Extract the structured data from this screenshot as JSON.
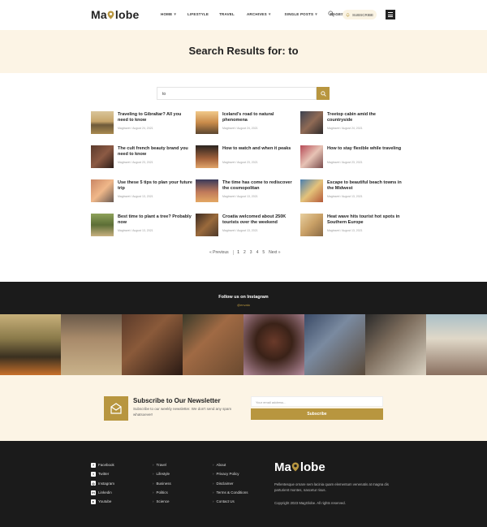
{
  "brand": {
    "logo_pre": "Ma",
    "logo_post": "lobe",
    "accent": "#b8963f",
    "cream": "#fcf4e5",
    "dark": "#1b1b1b"
  },
  "header": {
    "nav": [
      {
        "label": "Home",
        "has_dropdown": true
      },
      {
        "label": "Lifestyle",
        "has_dropdown": false
      },
      {
        "label": "Travel",
        "has_dropdown": false
      },
      {
        "label": "Archives",
        "has_dropdown": true
      },
      {
        "label": "Single Posts",
        "has_dropdown": true
      },
      {
        "label": "Pages",
        "has_dropdown": true
      }
    ],
    "search_icon": "search-icon",
    "subscribe_label": "Subscribe",
    "menu_icon": "hamburger-icon"
  },
  "page": {
    "title": "Search Results for: to"
  },
  "search": {
    "value": "to",
    "button_icon": "search-icon"
  },
  "results": [
    {
      "title": "Traveling to Gibraltar? All you need to know",
      "meta": "Magtravel / August 24, 2021"
    },
    {
      "title": "Iceland’s road to natural phenomena",
      "meta": "Magtravel / August 24, 2021"
    },
    {
      "title": "Treetop cabin amid the countryside",
      "meta": "Magtravel / August 24, 2021"
    },
    {
      "title": "The cult french beauty brand you need to know",
      "meta": "Magtravel / August 23, 2021"
    },
    {
      "title": "How to watch and when it peaks",
      "meta": "Magtravel / August 23, 2021"
    },
    {
      "title": "How to stay flexible while traveling",
      "meta": "Magtravel / August 23, 2021"
    },
    {
      "title": "Use these 5 tips to plan your future trip",
      "meta": "Magtravel / August 13, 2021"
    },
    {
      "title": "The time has come to rediscover the cosmopolitan",
      "meta": "Magtravel / August 13, 2021"
    },
    {
      "title": "Escape to beautiful beach towns in the Midwest",
      "meta": "Magtravel / August 13, 2021"
    },
    {
      "title": "Best time to plant a tree? Probably now",
      "meta": "Magtravel / August 13, 2021"
    },
    {
      "title": "Croatia welcomed about 250K tourists over the weekend",
      "meta": "Magtravel / August 13, 2021"
    },
    {
      "title": "Heat wave hits tourist hot spots in Southern Europe",
      "meta": "Magtravel / August 13, 2021"
    }
  ],
  "pagination": {
    "prev": "« Previous",
    "pages": [
      "1",
      "2",
      "3",
      "4",
      "5"
    ],
    "current": "1",
    "next": "Next »"
  },
  "instagram": {
    "title": "Follow us on Instagram",
    "handle": "@envato"
  },
  "newsletter": {
    "title": "Subscribe to Our Newsletter",
    "desc": "Subscribe to our weekly newsletter. We don't send any spam whatsoever!",
    "placeholder": "Your email address...",
    "button": "Subscribe",
    "icon": "envelope-icon"
  },
  "footer": {
    "col1": [
      {
        "label": "Facebook",
        "icon": "facebook-icon",
        "glyph": "f"
      },
      {
        "label": "Twitter",
        "icon": "twitter-icon",
        "glyph": "t"
      },
      {
        "label": "Instagram",
        "icon": "instagram-icon",
        "glyph": "◎"
      },
      {
        "label": "Linkedin",
        "icon": "linkedin-icon",
        "glyph": "in"
      },
      {
        "label": "Youtube",
        "icon": "youtube-icon",
        "glyph": "▸"
      }
    ],
    "col2": [
      "Travel",
      "Lifestyle",
      "Business",
      "Politics",
      "Science"
    ],
    "col3": [
      "About",
      "Privacy Policy",
      "Disclaimer",
      "Terms & Conditions",
      "Contact Us"
    ],
    "desc": "Pellentesque ornare sem lacinia quam elementum venenatis at magna dis parturient montes, nascetur risus.",
    "copyright": "Copyright 2023 MagGlobe. All rights reserved."
  }
}
